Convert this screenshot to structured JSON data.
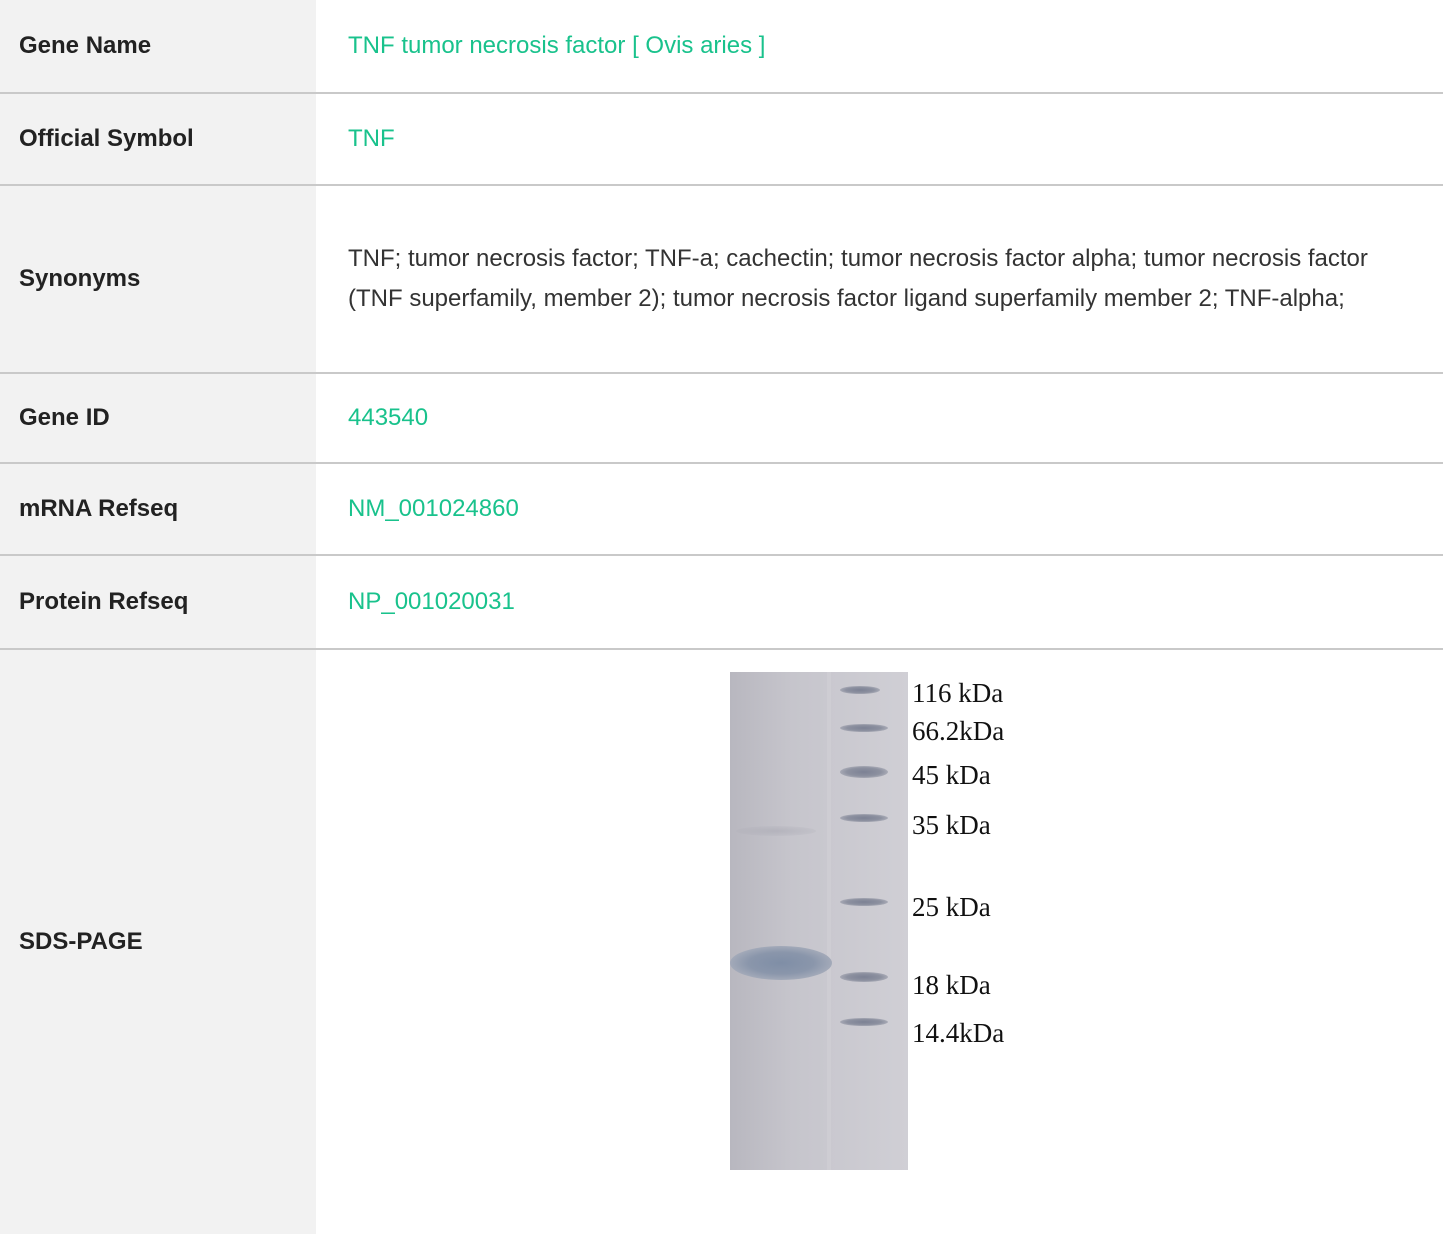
{
  "rows": [
    {
      "label": "Gene Name",
      "value": "TNF tumor necrosis factor [ Ovis aries ]"
    },
    {
      "label": "Official Symbol",
      "value": "TNF"
    },
    {
      "label": "Synonyms",
      "value": "TNF; tumor necrosis factor; TNF-a; cachectin; tumor necrosis factor alpha; tumor necrosis factor (TNF superfamily, member 2); tumor necrosis factor ligand superfamily member 2; TNF-alpha;"
    },
    {
      "label": "Gene ID",
      "value": "443540"
    },
    {
      "label": "mRNA Refseq",
      "value": "NM_001024860"
    },
    {
      "label": "Protein Refseq",
      "value": "NP_001020031"
    },
    {
      "label": "SDS-PAGE"
    }
  ],
  "gel": {
    "markers": [
      "116  kDa",
      "66.2kDa",
      "45  kDa",
      "35  kDa",
      "25 kDa",
      "18  kDa",
      "14.4kDa"
    ]
  },
  "colors": {
    "link": "#19c28c",
    "label_bg": "#f2f2f2",
    "divider": "#c9c9c9"
  }
}
